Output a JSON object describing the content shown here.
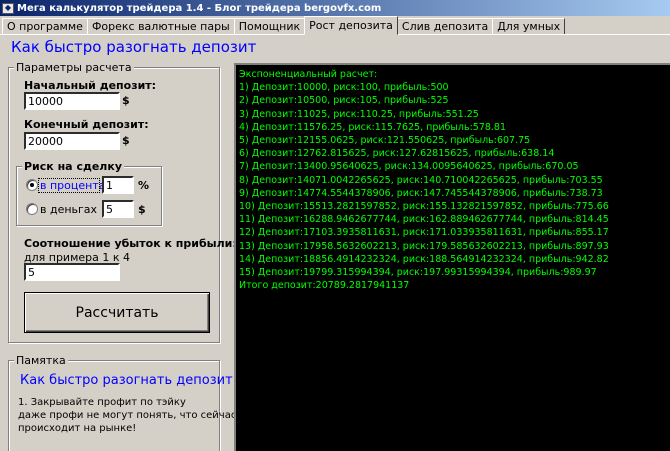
{
  "window": {
    "title": "Мега калькулятор трейдера 1.4 - Блог трейдера bergovfx.com"
  },
  "tabs": [
    {
      "label": "О программе"
    },
    {
      "label": "Форекс валютные пары"
    },
    {
      "label": "Помощник"
    },
    {
      "label": "Рост депозита"
    },
    {
      "label": "Слив депозита"
    },
    {
      "label": "Для умных"
    }
  ],
  "active_tab": "Рост депозита",
  "heading": "Как быстро разогнать депозит",
  "params": {
    "legend": "Параметры расчета",
    "initial_label": "Начальный депозит:",
    "initial_value": "10000",
    "initial_unit": "$",
    "final_label": "Конечный депозит:",
    "final_value": "20000",
    "final_unit": "$",
    "risk": {
      "legend": "Риск на сделку",
      "percent_label": "в процентах",
      "percent_value": "1",
      "percent_unit": "%",
      "money_label": "в деньгах",
      "money_value": "5",
      "money_unit": "$",
      "selected": "в процентах"
    },
    "ratio_label": "Соотношение убыток к прибыли:",
    "ratio_hint": "для примера 1 к 4",
    "ratio_value": "5",
    "calc_button": "Рассчитать"
  },
  "memo": {
    "legend": "Памятка",
    "title": "Как быстро разогнать депозит:",
    "text": "1. Закрывайте профит по тэйку\nдаже профи не могут понять, что сейчас\nпроисходит на рынке!"
  },
  "output": {
    "lines": [
      "Экспоненциальный расчет:",
      "1) Депозит:10000, риск:100, прибыль:500",
      "2) Депозит:10500, риск:105, прибыль:525",
      "3) Депозит:11025, риск:110.25, прибыль:551.25",
      "4) Депозит:11576.25, риск:115.7625, прибыль:578.81",
      "5) Депозит:12155.0625, риск:121.550625, прибыль:607.75",
      "6) Депозит:12762.815625, риск:127.62815625, прибыль:638.14",
      "7) Депозит:13400.95640625, риск:134.0095640625, прибыль:670.05",
      "8) Депозит:14071.0042265625, риск:140.710042265625, прибыль:703.55",
      "9) Депозит:14774.5544378906, риск:147.745544378906, прибыль:738.73",
      "10) Депозит:15513.2821597852, риск:155.132821597852, прибыль:775.66",
      "11) Депозит:16288.9462677744, риск:162.889462677744, прибыль:814.45",
      "12) Депозит:17103.3935811631, риск:171.033935811631, прибыль:855.17",
      "13) Депозит:17958.5632602213, риск:179.585632602213, прибыль:897.93",
      "14) Депозит:18856.4914232324, риск:188.564914232324, прибыль:942.82",
      "15) Депозит:19799.315994394, риск:197.99315994394, прибыль:989.97",
      "Итого депозит:20789.2817941137"
    ]
  },
  "colors": {
    "heading": "#0000ff",
    "console_bg": "#000000",
    "console_text": "#00ff00",
    "window_bg": "#d4d0c8"
  }
}
